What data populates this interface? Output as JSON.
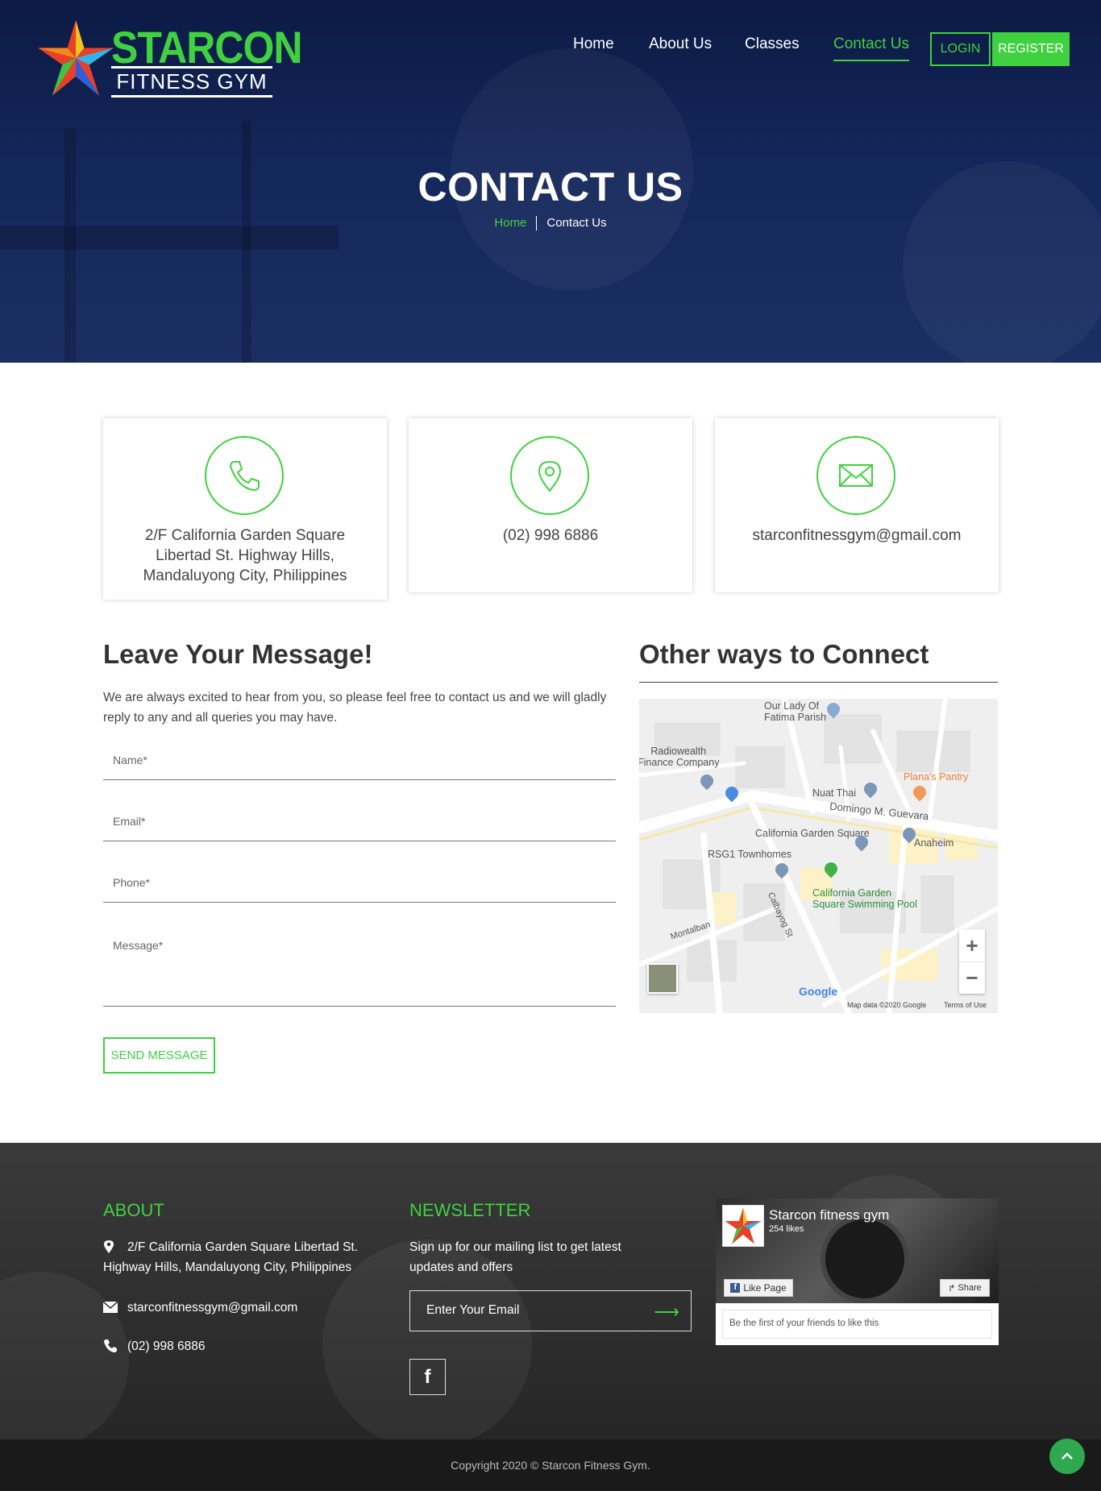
{
  "brand": {
    "name_top": "STARCON",
    "name_bottom": "FITNESS GYM"
  },
  "nav": {
    "items": [
      "Home",
      "About Us",
      "Classes",
      "Contact Us"
    ],
    "active": "Contact Us",
    "login": "LOGIN",
    "register": "REGISTER"
  },
  "hero": {
    "title": "CONTACT US",
    "breadcrumb_home": "Home",
    "breadcrumb_current": "Contact Us"
  },
  "cards": [
    {
      "icon": "phone-icon",
      "text": "2/F California Garden Square Libertad St. Highway Hills, Mandaluyong City, Philippines"
    },
    {
      "icon": "location-pin-icon",
      "text": "(02) 998 6886"
    },
    {
      "icon": "envelope-icon",
      "text": "starconfitnessgym@gmail.com"
    }
  ],
  "form": {
    "title": "Leave Your Message!",
    "intro": "We are always excited to hear from you, so please feel free to contact us and we will gladly reply to any and all queries you may have.",
    "name_placeholder": "Name*",
    "email_placeholder": "Email*",
    "phone_placeholder": "Phone*",
    "message_placeholder": "Message*",
    "submit": "SEND MESSAGE"
  },
  "connect": {
    "title": "Other ways to Connect",
    "map_labels": {
      "our_lady": "Our Lady Of\nFatima Parish",
      "radiowealth": "Radiowealth\nFinance Company",
      "planas": "Plana's Pantry",
      "nuat": "Nuat Thai",
      "domingo": "Domingo M. Guevara",
      "cgs": "California Garden Square",
      "anaheim": "Anaheim",
      "rsg1": "RSG1 Townhomes",
      "pool": "California Garden\nSquare Swimming Pool",
      "montalban": "Montalban",
      "calbayog": "Calbayog St",
      "google": "Google",
      "mapdata": "Map data ©2020 Google",
      "terms": "Terms of Use"
    },
    "zoom_in": "+",
    "zoom_out": "−"
  },
  "footer": {
    "about_title": "ABOUT",
    "address": "2/F California Garden Square Libertad St. Highway Hills, Mandaluyong City, Philippines",
    "email": "starconfitnessgym@gmail.com",
    "phone": "(02) 998 6886",
    "newsletter_title": "NEWSLETTER",
    "newsletter_text": "Sign up for our mailing list to get latest updates and offers",
    "email_placeholder": "Enter Your Email",
    "fb_page": {
      "name": "Starcon fitness gym",
      "likes": "254 likes",
      "like_button": "Like Page",
      "share_button": "Share",
      "friends_text": "Be the first of your friends to like this"
    },
    "copyright": "Copyright 2020 © Starcon Fitness Gym."
  },
  "colors": {
    "accent": "#3fd13f",
    "hero_bg": "#0c1a44",
    "footer_bg": "#2a2a2a"
  }
}
